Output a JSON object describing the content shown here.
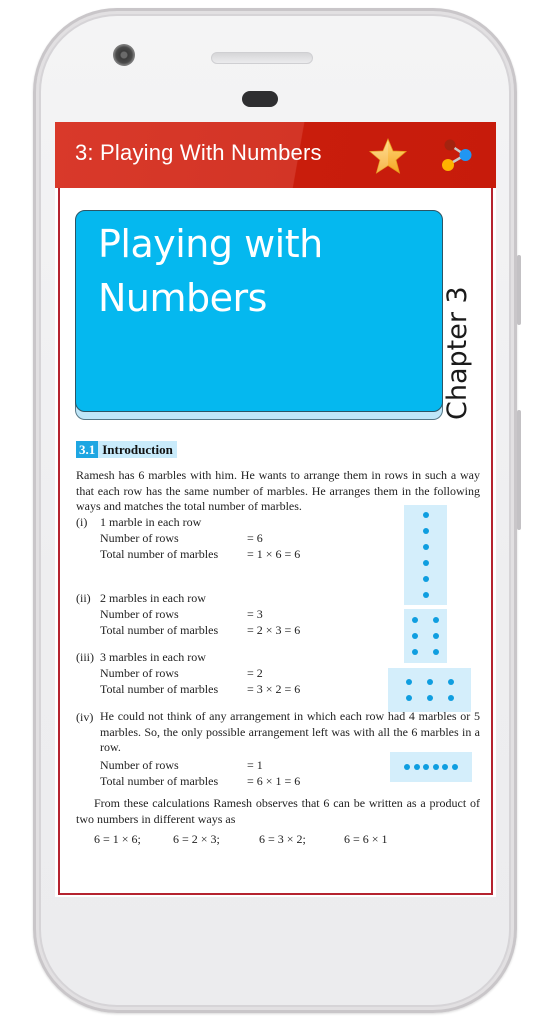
{
  "app_bar": {
    "title": "3: Playing With Numbers",
    "icons": [
      "star-icon",
      "share-icon"
    ],
    "color": "#d33526"
  },
  "chapter": {
    "banner_title_line1": "Playing with",
    "banner_title_line2": "Numbers",
    "side_label": "Chapter 3",
    "banner_color": "#05b8ef"
  },
  "section": {
    "number": "3.1",
    "title": "Introduction"
  },
  "content": {
    "intro": "Ramesh has 6 marbles with him. He wants to arrange them in rows in such a way that each row has the same number of marbles. He arranges them in the following ways and matches the total number of marbles.",
    "cases": [
      {
        "label": "(i)",
        "heading": "1 marble in each row",
        "rows_label": "Number of rows",
        "rows_value": "= 6",
        "total_label": "Total number of marbles",
        "total_value": "= 1 × 6 = 6",
        "grid": {
          "cols": 1,
          "rows": 6
        }
      },
      {
        "label": "(ii)",
        "heading": "2 marbles in each row",
        "rows_label": "Number of rows",
        "rows_value": "= 3",
        "total_label": "Total number of marbles",
        "total_value": "= 2 × 3 = 6",
        "grid": {
          "cols": 2,
          "rows": 3
        }
      },
      {
        "label": "(iii)",
        "heading": "3 marbles in each row",
        "rows_label": "Number of rows",
        "rows_value": "= 2",
        "total_label": "Total number of marbles",
        "total_value": "= 3 × 2 = 6",
        "grid": {
          "cols": 3,
          "rows": 2
        }
      },
      {
        "label": "(iv)",
        "heading": "He could not think of any arrangement in which each row had 4 marbles or 5 marbles. So, the only possible arrangement left was with all the 6 marbles in a row.",
        "rows_label": "Number of rows",
        "rows_value": "= 1",
        "total_label": "Total number of marbles",
        "total_value": "= 6 × 1 = 6",
        "grid": {
          "cols": 6,
          "rows": 1
        }
      }
    ],
    "conclusion": "From these calculations Ramesh observes that 6 can be written as a product of two numbers in different ways as",
    "products": [
      "6 = 1 × 6;",
      "6 = 2 × 3;",
      "6 = 3 × 2;",
      "6 = 6 × 1"
    ]
  }
}
